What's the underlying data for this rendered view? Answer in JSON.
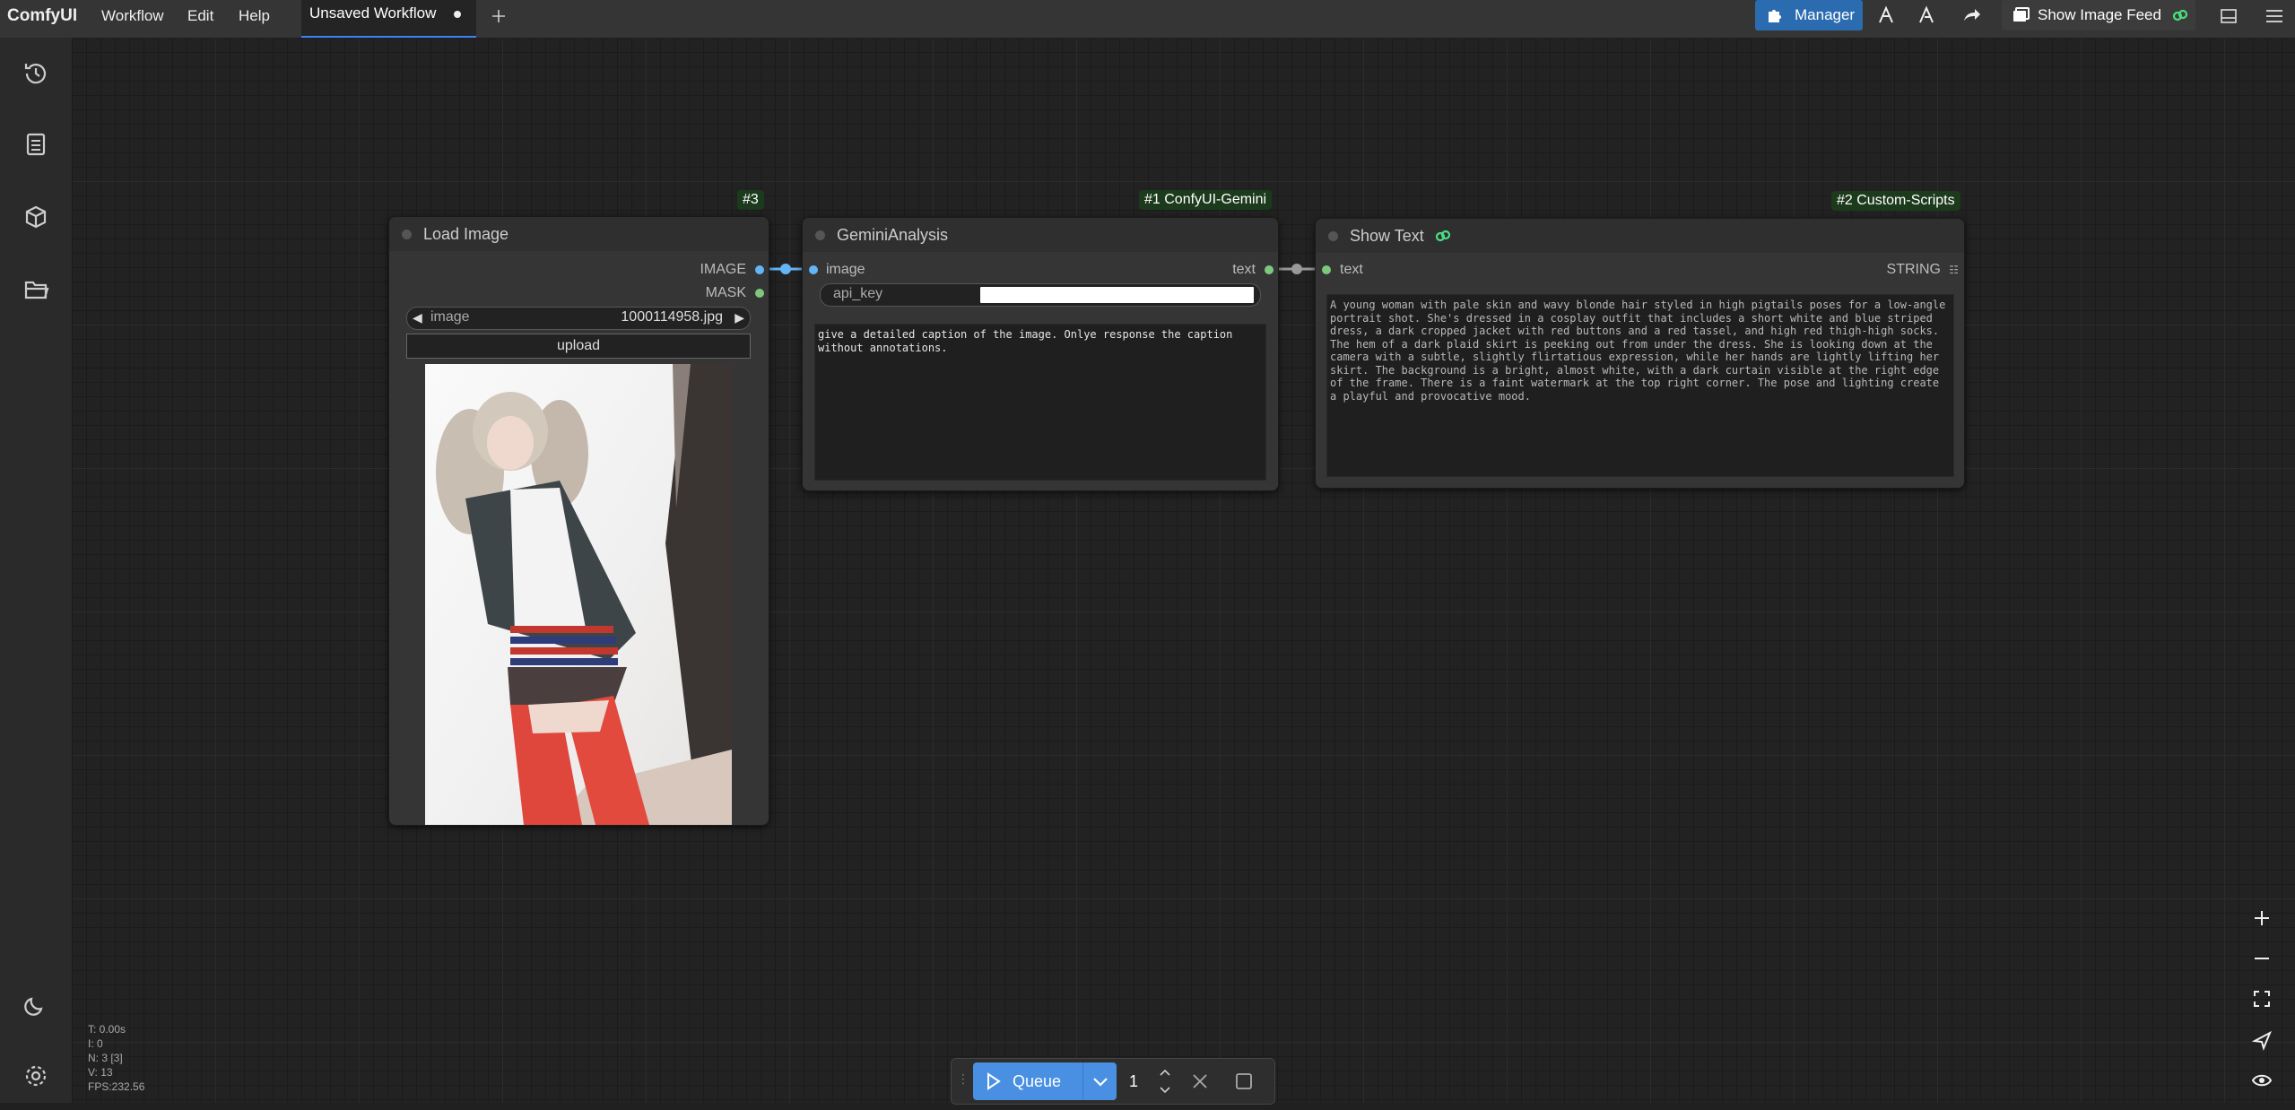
{
  "menubar": {
    "brand": "ComfyUI",
    "items": [
      "Workflow",
      "Edit",
      "Help"
    ],
    "active_tab": "Unsaved Workflow",
    "add_tab_icon": "plus-icon"
  },
  "toolbar": {
    "manager_label": "Manager",
    "show_image_feed_label": "Show Image Feed",
    "icons": [
      "puzzle-icon",
      "comfy-logo-icon",
      "comfy-logo-outline-icon",
      "share-icon",
      "image-feed-icon",
      "panel-toggle-icon",
      "hamburger-menu-icon"
    ]
  },
  "sidebar": {
    "items": [
      "history-icon",
      "queue-list-icon",
      "model-library-icon",
      "workflows-folder-icon"
    ],
    "bottom": [
      "theme-moon-icon",
      "settings-gear-icon"
    ]
  },
  "nodes": {
    "load_image": {
      "badge": "#3",
      "title": "Load Image",
      "outputs": [
        "IMAGE",
        "MASK"
      ],
      "image_widget_label": "image",
      "image_widget_value": "1000114958.jpg",
      "upload_label": "upload"
    },
    "gemini": {
      "badge": "#1 ConfyUI-Gemini",
      "title": "GeminiAnalysis",
      "input": "image",
      "output": "text",
      "api_key_label": "api_key",
      "prompt": "give a detailed caption of the image. Onlye response the caption without annotations."
    },
    "show_text": {
      "badge": "#2 Custom-Scripts",
      "title": "Show Text",
      "input": "text",
      "output": "STRING",
      "content": "A young woman with pale skin and wavy blonde hair styled in high pigtails poses for a low-angle portrait shot. She's dressed in a cosplay outfit that includes a short white and blue striped dress, a dark cropped jacket with red buttons and a red tassel, and high red thigh-high socks. The hem of a dark plaid skirt is peeking out from under the dress. She is looking down at the camera with a subtle, slightly flirtatious expression, while her hands are lightly lifting her skirt. The background is a bright, almost white, with a dark curtain visible at the right edge of the frame. There is a faint watermark at the top right corner. The pose and lighting create a playful and provocative mood."
    }
  },
  "stats": {
    "t": "T: 0.00s",
    "i": "I: 0",
    "n": "N: 3 [3]",
    "v": "V: 13",
    "fps": "FPS:232.56"
  },
  "queue": {
    "label": "Queue",
    "count": "1"
  },
  "colors": {
    "accent": "#4a90e2",
    "manager": "#2b6cb0",
    "image_link": "#64b5f6",
    "string_link": "#7ec87e"
  }
}
